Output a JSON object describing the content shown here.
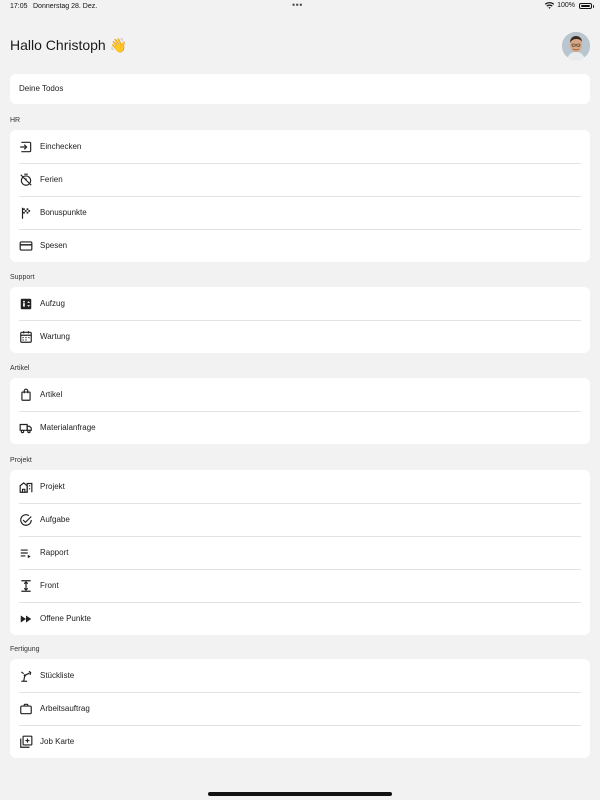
{
  "status_bar": {
    "time": "17:05",
    "date": "Donnerstag 28. Dez.",
    "dots": "•••",
    "battery": "100%"
  },
  "header": {
    "greeting": "Hallo Christoph 👋"
  },
  "todos": {
    "label": "Deine Todos"
  },
  "sections": {
    "hr": {
      "title": "HR",
      "items": [
        {
          "label": "Einchecken",
          "icon": "login-icon"
        },
        {
          "label": "Ferien",
          "icon": "timer-off-icon"
        },
        {
          "label": "Bonuspunkte",
          "icon": "checkered-flag-icon"
        },
        {
          "label": "Spesen",
          "icon": "credit-card-icon"
        }
      ]
    },
    "support": {
      "title": "Support",
      "items": [
        {
          "label": "Aufzug",
          "icon": "elevator-icon"
        },
        {
          "label": "Wartung",
          "icon": "calendar-icon"
        }
      ]
    },
    "artikel": {
      "title": "Artikel",
      "items": [
        {
          "label": "Artikel",
          "icon": "shopping-bag-icon"
        },
        {
          "label": "Materialanfrage",
          "icon": "truck-icon"
        }
      ]
    },
    "projekt": {
      "title": "Projekt",
      "items": [
        {
          "label": "Projekt",
          "icon": "buildings-icon"
        },
        {
          "label": "Aufgabe",
          "icon": "check-circle-icon"
        },
        {
          "label": "Rapport",
          "icon": "playlist-icon"
        },
        {
          "label": "Front",
          "icon": "height-icon"
        },
        {
          "label": "Offene Punkte",
          "icon": "fast-forward-icon"
        }
      ]
    },
    "fertigung": {
      "title": "Fertigung",
      "items": [
        {
          "label": "Stückliste",
          "icon": "precision-manufacturing-icon"
        },
        {
          "label": "Arbeitsauftrag",
          "icon": "work-icon"
        },
        {
          "label": "Job Karte",
          "icon": "library-add-icon"
        }
      ]
    }
  }
}
